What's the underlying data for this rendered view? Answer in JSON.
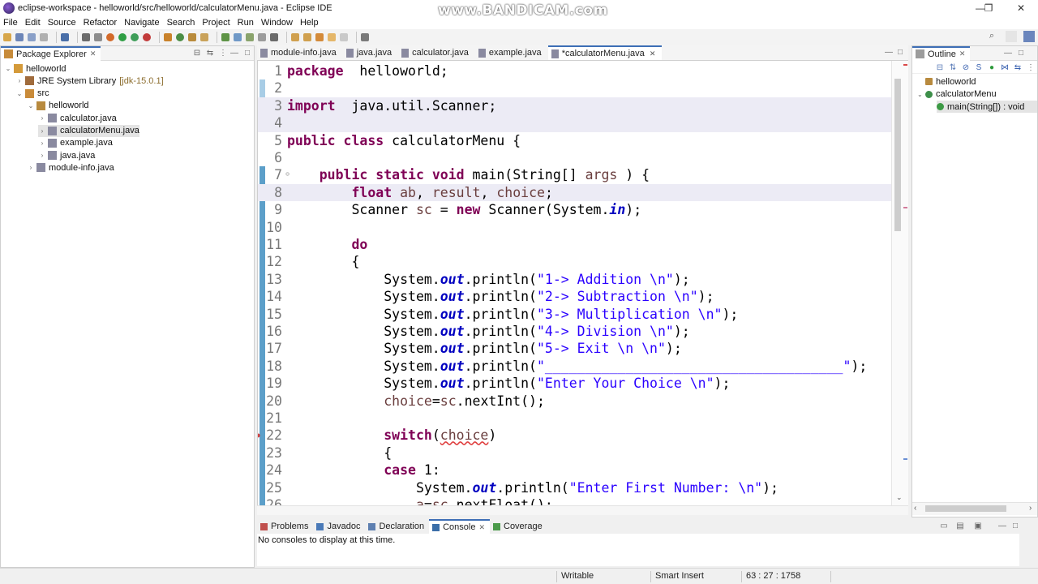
{
  "window": {
    "title": "eclipse-workspace - helloworld/src/helloworld/calculatorMenu.java - Eclipse IDE",
    "watermark": "www.BANDICAM.com",
    "minimize_glyph": "—",
    "restore_glyph": "❐",
    "close_glyph": "✕"
  },
  "menu": [
    "File",
    "Edit",
    "Source",
    "Refactor",
    "Navigate",
    "Search",
    "Project",
    "Run",
    "Window",
    "Help"
  ],
  "package_explorer": {
    "title": "Package Explorer",
    "tree": [
      {
        "label": "helloworld",
        "icon": "project-icon",
        "expanded": true
      },
      {
        "label": "JRE System Library",
        "suffix": "[jdk-15.0.1]",
        "icon": "library-icon",
        "expanded": false
      },
      {
        "label": "src",
        "icon": "source-folder-icon",
        "expanded": true
      },
      {
        "label": "helloworld",
        "icon": "package-icon",
        "expanded": true
      },
      {
        "label": "calculator.java",
        "icon": "java-file-icon",
        "expanded": false
      },
      {
        "label": "calculatorMenu.java",
        "icon": "java-file-icon",
        "expanded": false,
        "selected": true
      },
      {
        "label": "example.java",
        "icon": "java-file-icon",
        "expanded": false
      },
      {
        "label": "java.java",
        "icon": "java-file-icon",
        "expanded": false
      },
      {
        "label": "module-info.java",
        "icon": "java-file-icon",
        "expanded": false
      }
    ]
  },
  "editor": {
    "tabs": [
      {
        "label": "module-info.java",
        "active": false
      },
      {
        "label": "java.java",
        "active": false
      },
      {
        "label": "calculator.java",
        "active": false
      },
      {
        "label": "example.java",
        "active": false
      },
      {
        "label": "*calculatorMenu.java",
        "active": true
      }
    ],
    "lines": [
      {
        "n": "1",
        "tokens": [
          [
            "kw",
            "package"
          ],
          [
            "",
            "  helloworld;"
          ]
        ]
      },
      {
        "n": "2",
        "tokens": []
      },
      {
        "n": "3",
        "tokens": [
          [
            "kw",
            "import"
          ],
          [
            "",
            "  java.util.Scanner;"
          ]
        ]
      },
      {
        "n": "4",
        "tokens": []
      },
      {
        "n": "5",
        "tokens": [
          [
            "kw",
            "public"
          ],
          [
            "",
            " "
          ],
          [
            "kw",
            "class"
          ],
          [
            "",
            " calculatorMenu {"
          ]
        ]
      },
      {
        "n": "6",
        "tokens": []
      },
      {
        "n": "7",
        "tokens": [
          [
            "",
            "    "
          ],
          [
            "kw",
            "public"
          ],
          [
            "",
            " "
          ],
          [
            "kw",
            "static"
          ],
          [
            "",
            " "
          ],
          [
            "kw",
            "void"
          ],
          [
            "",
            " main(String[] "
          ],
          [
            "var",
            "args"
          ],
          [
            "",
            " ) {"
          ]
        ]
      },
      {
        "n": "8",
        "tokens": [
          [
            "",
            "        "
          ],
          [
            "kw",
            "float"
          ],
          [
            "",
            " "
          ],
          [
            "var",
            "a"
          ],
          [
            ", ",
            ""
          ],
          [
            "var",
            "b"
          ],
          [
            "",
            ", "
          ],
          [
            "var",
            "result"
          ],
          [
            "",
            ", "
          ],
          [
            "var",
            "choice"
          ],
          [
            "",
            ";"
          ]
        ]
      },
      {
        "n": "9",
        "tokens": [
          [
            "",
            "        Scanner "
          ],
          [
            "var",
            "sc"
          ],
          [
            "",
            " = "
          ],
          [
            "kw",
            "new"
          ],
          [
            "",
            " Scanner(System."
          ],
          [
            "fld",
            "in"
          ],
          [
            "",
            ");"
          ]
        ]
      },
      {
        "n": "10",
        "tokens": []
      },
      {
        "n": "11",
        "tokens": [
          [
            "",
            "        "
          ],
          [
            "kw",
            "do"
          ]
        ]
      },
      {
        "n": "12",
        "tokens": [
          [
            "",
            "        {"
          ]
        ]
      },
      {
        "n": "13",
        "tokens": [
          [
            "",
            "            System."
          ],
          [
            "fld",
            "out"
          ],
          [
            "",
            ".println("
          ],
          [
            "str",
            "\"1-> Addition \\n\""
          ],
          [
            "",
            ");"
          ]
        ]
      },
      {
        "n": "14",
        "tokens": [
          [
            "",
            "            System."
          ],
          [
            "fld",
            "out"
          ],
          [
            "",
            ".println("
          ],
          [
            "str",
            "\"2-> Subtraction \\n\""
          ],
          [
            "",
            ");"
          ]
        ]
      },
      {
        "n": "15",
        "tokens": [
          [
            "",
            "            System."
          ],
          [
            "fld",
            "out"
          ],
          [
            "",
            ".println("
          ],
          [
            "str",
            "\"3-> Multiplication \\n\""
          ],
          [
            "",
            ");"
          ]
        ]
      },
      {
        "n": "16",
        "tokens": [
          [
            "",
            "            System."
          ],
          [
            "fld",
            "out"
          ],
          [
            "",
            ".println("
          ],
          [
            "str",
            "\"4-> Division \\n\""
          ],
          [
            "",
            ");"
          ]
        ]
      },
      {
        "n": "17",
        "tokens": [
          [
            "",
            "            System."
          ],
          [
            "fld",
            "out"
          ],
          [
            "",
            ".println("
          ],
          [
            "str",
            "\"5-> Exit \\n \\n\""
          ],
          [
            "",
            ");"
          ]
        ]
      },
      {
        "n": "18",
        "tokens": [
          [
            "",
            "            System."
          ],
          [
            "fld",
            "out"
          ],
          [
            "",
            ".println("
          ],
          [
            "str",
            "\"_____________________________________\""
          ],
          [
            "",
            ");"
          ]
        ]
      },
      {
        "n": "19",
        "tokens": [
          [
            "",
            "            System."
          ],
          [
            "fld",
            "out"
          ],
          [
            "",
            ".println("
          ],
          [
            "str",
            "\"Enter Your Choice \\n\""
          ],
          [
            "",
            ");"
          ]
        ]
      },
      {
        "n": "20",
        "tokens": [
          [
            "",
            "            "
          ],
          [
            "var",
            "choice"
          ],
          [
            "",
            "="
          ],
          [
            "var",
            "sc"
          ],
          [
            "",
            ".nextInt();"
          ]
        ]
      },
      {
        "n": "21",
        "tokens": []
      },
      {
        "n": "22",
        "tokens": [
          [
            "",
            "            "
          ],
          [
            "kw",
            "switch"
          ],
          [
            "",
            "("
          ],
          [
            "errvar",
            "choice"
          ],
          [
            "",
            ")"
          ]
        ]
      },
      {
        "n": "23",
        "tokens": [
          [
            "",
            "            {"
          ]
        ]
      },
      {
        "n": "24",
        "tokens": [
          [
            "",
            "            "
          ],
          [
            "kw",
            "case"
          ],
          [
            "",
            " 1:"
          ]
        ]
      },
      {
        "n": "25",
        "tokens": [
          [
            "",
            "                System."
          ],
          [
            "fld",
            "out"
          ],
          [
            "",
            ".println("
          ],
          [
            "str",
            "\"Enter First Number: \\n\""
          ],
          [
            "",
            ");"
          ]
        ]
      },
      {
        "n": "26",
        "tokens": [
          [
            "",
            "                "
          ],
          [
            "var",
            "a"
          ],
          [
            "",
            "="
          ],
          [
            "var",
            "sc"
          ],
          [
            "",
            ".nextFloat();"
          ]
        ]
      }
    ]
  },
  "outline": {
    "title": "Outline",
    "items": [
      {
        "label": "helloworld",
        "icon": "package-icon"
      },
      {
        "label": "calculatorMenu",
        "icon": "class-icon"
      },
      {
        "label": "main(String[]) : void",
        "icon": "method-icon"
      }
    ]
  },
  "console": {
    "tabs": [
      {
        "label": "Problems",
        "icon": "problems-icon",
        "active": false
      },
      {
        "label": "Javadoc",
        "icon": "javadoc-icon",
        "active": false
      },
      {
        "label": "Declaration",
        "icon": "declaration-icon",
        "active": false
      },
      {
        "label": "Console",
        "icon": "console-icon",
        "active": true
      },
      {
        "label": "Coverage",
        "icon": "coverage-icon",
        "active": false
      }
    ],
    "message": "No consoles to display at this time."
  },
  "status": {
    "mode": "Writable",
    "insert": "Smart Insert",
    "position": "63 : 27 : 1758"
  },
  "colors": {
    "keyword": "#7f0055",
    "string": "#2a00ff",
    "field": "#0000c0",
    "local_var": "#6a3e3e",
    "active_tab_border": "#3d6eb5"
  }
}
